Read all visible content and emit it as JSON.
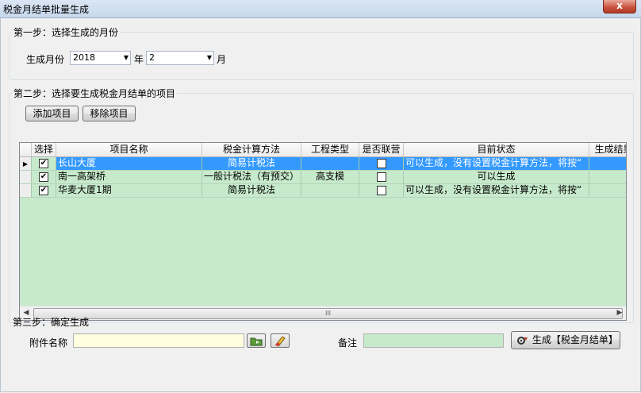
{
  "window": {
    "title": "税金月结单批量生成",
    "close_glyph": "x"
  },
  "step1": {
    "legend": "第一步：选择生成的月份",
    "month_label": "生成月份",
    "year_value": "2018",
    "year_unit": "年",
    "month_value": "2",
    "month_unit": "月"
  },
  "step2": {
    "legend": "第二步：选择要生成税金月结单的项目",
    "add_button": "添加项目",
    "remove_button": "移除项目",
    "columns": [
      "选择",
      "项目名称",
      "税金计算方法",
      "工程类型",
      "是否联营",
      "目前状态",
      "生成结果"
    ],
    "rows": [
      {
        "selected": true,
        "name": "长山大厦",
        "method": "简易计税法",
        "type": "",
        "joint": false,
        "status": "可以生成，没有设置税金计算方法，将按“",
        "result": ""
      },
      {
        "selected": true,
        "name": "南一高架桥",
        "method": "一般计税法（有预交）",
        "type": "高支模",
        "joint": false,
        "status": "可以生成",
        "result": ""
      },
      {
        "selected": true,
        "name": "华麦大厦1期",
        "method": "简易计税法",
        "type": "",
        "joint": false,
        "status": "可以生成，没有设置税金计算方法，将按“",
        "result": ""
      }
    ],
    "current_row": 0,
    "scroll_grip": "III"
  },
  "step3": {
    "legend": "第三步：确定生成",
    "attach_label": "附件名称",
    "attach_value": "",
    "note_label": "备注",
    "note_value": "",
    "generate_button": "生成【税金月结单】"
  },
  "colors": {
    "grid_bg": "#c7eacc",
    "selection": "#3399ff",
    "attach_bg": "#ffffe0"
  }
}
